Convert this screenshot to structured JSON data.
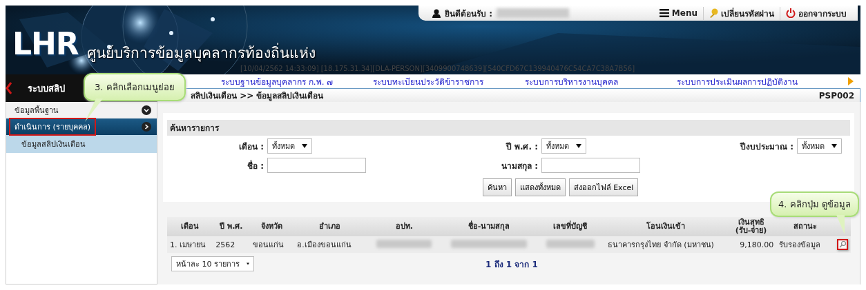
{
  "header": {
    "logo": "LHR",
    "title": "ศูนย์บริการข้อมูลบุคลากรท้องถิ่นแห่ง",
    "welcome_label": "ยินดีต้อนรับ :",
    "welcome_name_redacted": true,
    "top_links": [
      {
        "kind": "menu",
        "label": "Menu"
      },
      {
        "kind": "password",
        "label": "เปลี่ยนรหัสผ่าน"
      },
      {
        "kind": "logout",
        "label": "ออกจากระบบ"
      }
    ],
    "session_info": "[10/04/2562 14:33:09] [18.175.31.34][DLA-PERSON][3409900748639][540CFD67C139940476C54CA7C38A7B56]"
  },
  "nav": {
    "items": [
      {
        "label": "ระบบฐานข้อมูลบุคลากร ก.พ. ๗"
      },
      {
        "label": "ระบบทะเบียนประวัติข้าราชการ"
      },
      {
        "label": "ระบบการบริหารงานบุคคล"
      },
      {
        "label": "ระบบการประเมินผลการปฏิบัติงาน"
      }
    ]
  },
  "sidebar": {
    "title": "ระบบสลิป",
    "items": [
      {
        "kind": "section",
        "label": "ข้อมูลพื้นฐาน",
        "selected": false,
        "highlighted": false
      },
      {
        "kind": "section",
        "label": "ดำเนินการ (รายบุคคล)",
        "selected": true,
        "highlighted": true
      },
      {
        "kind": "sub",
        "label": "ข้อมูลสลิปเงินเดือน",
        "selected": false,
        "highlighted": false
      }
    ]
  },
  "content": {
    "breadcrumb": "สลิปเงินเดือน >> ข้อมูลสลิปเงินเดือน",
    "page_code": "PSP002",
    "search": {
      "title": "ค้นหารายการ",
      "fields": [
        {
          "kind": "select",
          "label": "เดือน :",
          "value": "ทั้งหมด"
        },
        {
          "kind": "select",
          "label": "ปี พ.ศ. :",
          "value": "ทั้งหมด"
        },
        {
          "kind": "select",
          "label": "ปีงบประมาณ :",
          "value": "ทั้งหมด"
        },
        {
          "kind": "input",
          "label": "ชื่อ :"
        },
        {
          "kind": "input",
          "label": "นามสกุล :"
        }
      ],
      "buttons": [
        "ค้นหา",
        "แสดงทั้งหมด",
        "ส่งออกไฟล์ Excel"
      ]
    },
    "table": {
      "columns": [
        "เดือน",
        "ปี พ.ศ.",
        "จังหวัด",
        "อำเภอ",
        "อปท.",
        "ชื่อ-นามสกุล",
        "เลขที่บัญชี",
        "โอนเงินเข้า",
        "เงินสุทธิ\n(รับ-จ่าย)",
        "สถานะ"
      ],
      "rows": [
        {
          "cells": [
            {
              "kind": "text",
              "text": "1. เมษายน"
            },
            {
              "kind": "text",
              "text": "2562"
            },
            {
              "kind": "text",
              "text": "ขอนแก่น"
            },
            {
              "kind": "text",
              "text": "อ.เมืองขอนแก่น"
            },
            {
              "kind": "redacted"
            },
            {
              "kind": "redacted"
            },
            {
              "kind": "redacted"
            },
            {
              "kind": "text",
              "text": "ธนาคารกรุงไทย จำกัด (มหาชน)"
            },
            {
              "kind": "number",
              "text": "9,180.00"
            },
            {
              "kind": "text",
              "text": "รับรองข้อมูล"
            },
            {
              "kind": "view",
              "highlighted": true
            }
          ]
        }
      ]
    },
    "page_size": "หน้าละ 10 รายการ",
    "pagination": "1 ถึง 1 จาก 1"
  },
  "callouts": [
    {
      "kind": "menu",
      "text": "3. คลิกเลือกเมนูย่อย"
    },
    {
      "kind": "view",
      "text": "4. คลิกปุ่ม ดูข้อมูล"
    }
  ]
}
